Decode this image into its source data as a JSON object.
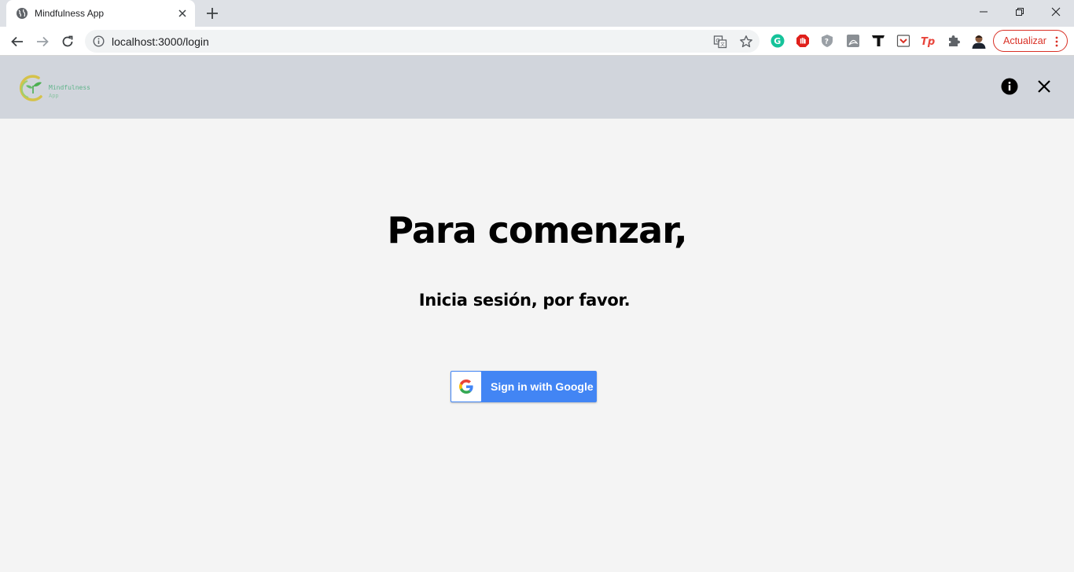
{
  "browser": {
    "tab": {
      "title": "Mindfulness App",
      "favicon": "globe-icon"
    },
    "address": {
      "url": "localhost:3000/login"
    },
    "update_button": {
      "label": "Actualizar"
    },
    "colors": {
      "tabstrip": "#dee1e6",
      "update_red": "#d93025"
    }
  },
  "app": {
    "logo": {
      "line1": "Mindfulness",
      "line2": "App"
    },
    "header_icons": [
      "info-icon",
      "close-icon"
    ],
    "colors": {
      "header_bg": "#d1d5dc",
      "page_bg": "#f4f4f4"
    }
  },
  "main": {
    "headline": "Para comenzar,",
    "subhead": "Inicia sesión, por favor.",
    "google_button": {
      "label": "Sign in with Google",
      "color": "#4285f4"
    }
  }
}
